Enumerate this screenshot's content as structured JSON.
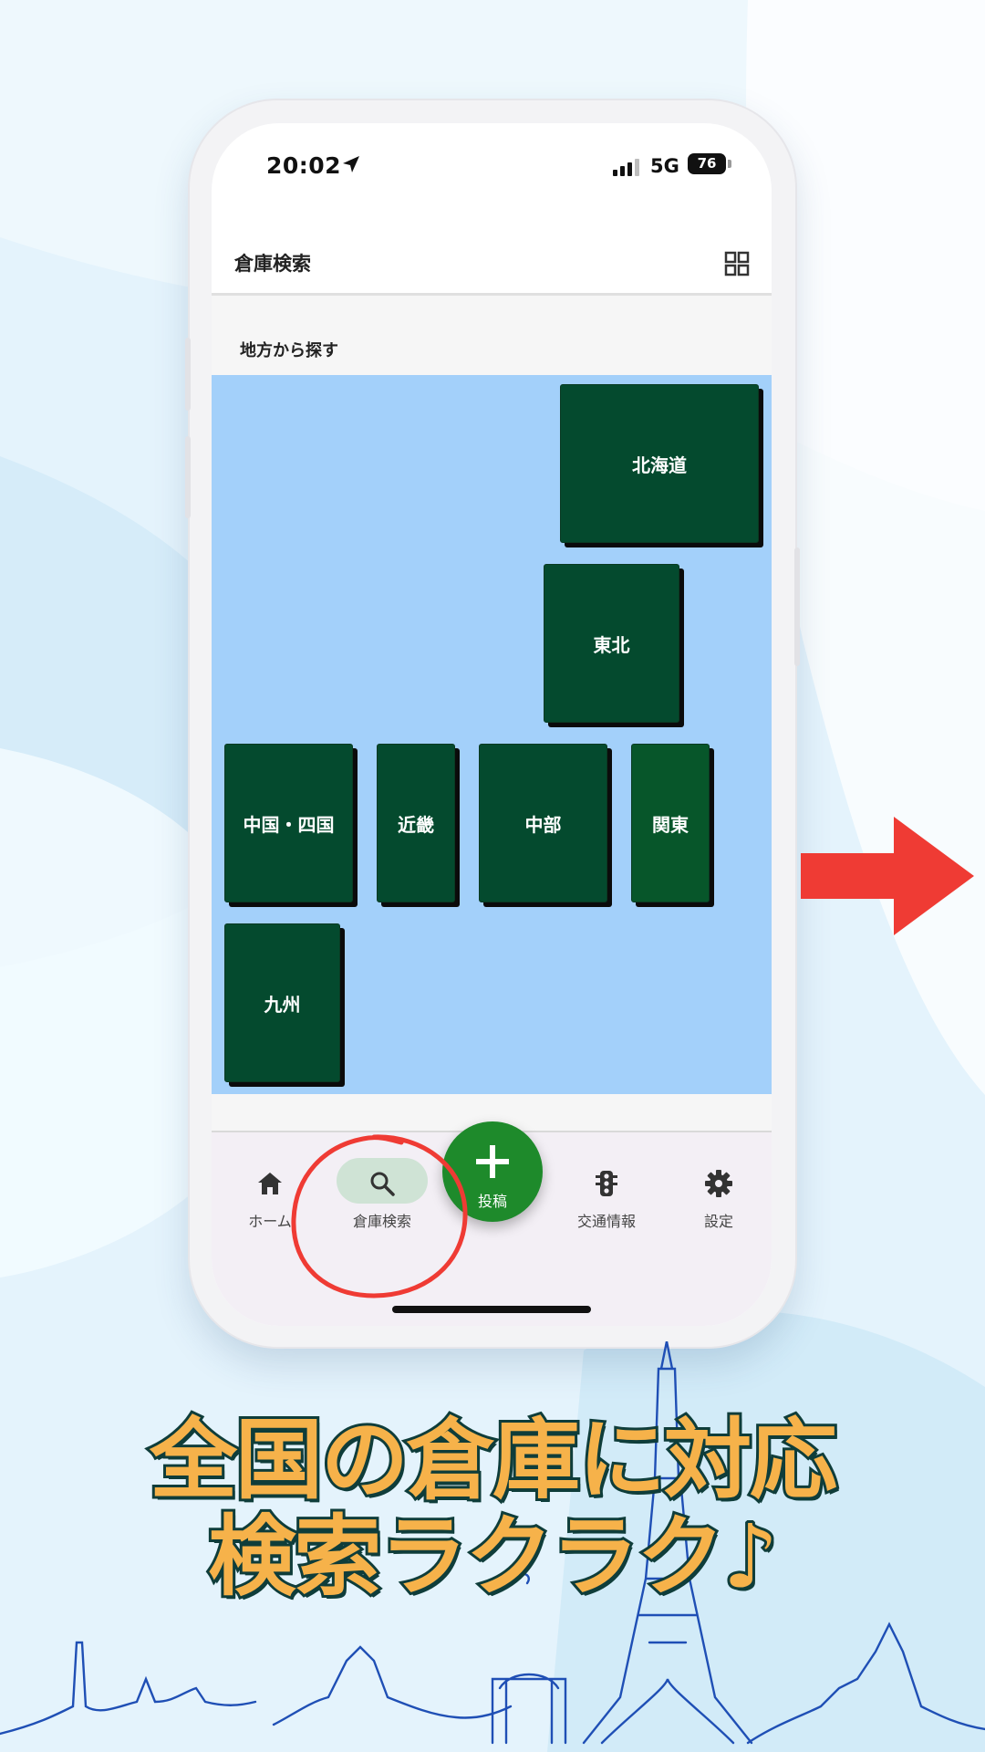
{
  "status_bar": {
    "time": "20:02",
    "network": "5G",
    "battery": "76"
  },
  "app_bar": {
    "title": "倉庫検索",
    "view_toggle_icon": "grid-icon"
  },
  "section": {
    "label": "地方から探す"
  },
  "regions": [
    {
      "label": "北海道"
    },
    {
      "label": "東北"
    },
    {
      "label": "中国・四国"
    },
    {
      "label": "近畿"
    },
    {
      "label": "中部"
    },
    {
      "label": "関東"
    },
    {
      "label": "九州"
    }
  ],
  "fab": {
    "label": "投稿",
    "icon": "plus-icon"
  },
  "bottom_nav": [
    {
      "label": "ホーム",
      "icon": "home-icon",
      "active": false
    },
    {
      "label": "倉庫検索",
      "icon": "search-icon",
      "active": true
    },
    {
      "label": "交通情報",
      "icon": "traffic-light-icon",
      "active": false
    },
    {
      "label": "設定",
      "icon": "gear-icon",
      "active": false
    }
  ],
  "promo": {
    "caption_line1": "全国の倉庫に対応",
    "caption_line2": "検索ラクラク♪"
  },
  "colors": {
    "region_green": "#044a2e",
    "map_blue": "#a3d0fa",
    "fab_green": "#1e8a2b",
    "arrow_red": "#ef3b34",
    "caption_fill": "#f6b24a",
    "caption_outline": "#0f3d3a",
    "nav_active_pill": "#cfe3d5"
  }
}
